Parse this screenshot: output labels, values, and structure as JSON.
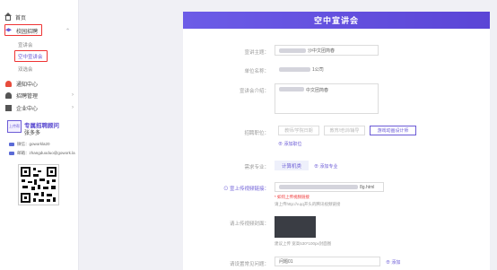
{
  "sidebar": {
    "home": "首页",
    "campus_recruit": "校园招聘",
    "sub_items": [
      "宣讲会",
      "空中宣讲会",
      "双选会"
    ],
    "notify": "通知中心",
    "recruit_manage": "招聘管理",
    "company_center": "企业中心",
    "promo": {
      "badge": "上传帮",
      "title": "专属招聘顾问",
      "subtitle": "张多多",
      "wechat": "微信：goworkla20",
      "email": "邮箱：zhangduoduo@gowork.la"
    }
  },
  "main": {
    "banner": "空中宣讲会",
    "fields": {
      "topic": {
        "label": "宣讲主题：",
        "value_suffix": "沙中文团简春"
      },
      "company": {
        "label": "单位名称：",
        "value_suffix": "1公司"
      },
      "intro": {
        "label": "宣讲会介绍：",
        "value_suffix": "中文团简春"
      },
      "positions": {
        "label": "招聘职位：",
        "options": [
          "教师/学院日期",
          "教育/培训/辅导",
          "游戏动画设计师"
        ],
        "add_link": "⊕ 添加职位"
      },
      "major": {
        "label": "需求专业：",
        "tag": "计算机类",
        "add_link": "⊕ 添加专业"
      },
      "video_link": {
        "label": "⊙ 宣上传视频链接：",
        "value_suffix": "8g.html",
        "hint_red": "* 如何上传视频链接",
        "hint": "请上传http://v.qq开头的腾讯视频链接"
      },
      "cover": {
        "label": "请上传视频封面：",
        "hint": "建议上传 宽高530*100px封面图"
      },
      "question": {
        "label": "请设置常见问题：",
        "value": "问题01",
        "add_link": "⊕ 添加"
      }
    }
  }
}
